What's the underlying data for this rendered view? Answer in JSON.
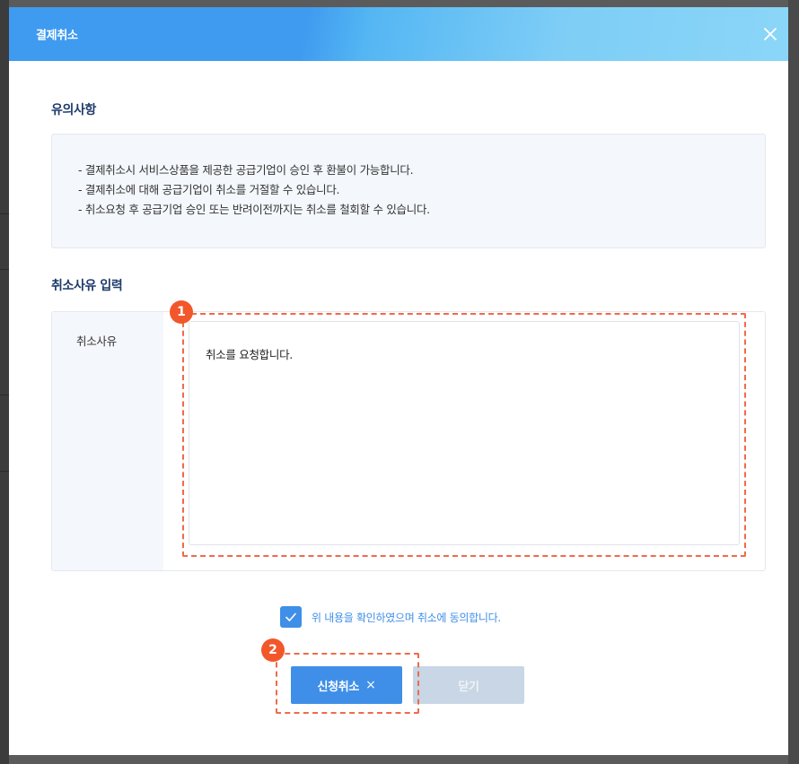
{
  "modal": {
    "title": "결제취소",
    "close_icon": "close-icon"
  },
  "notice": {
    "title": "유의사항",
    "lines": [
      "- 결제취소시 서비스상품을 제공한 공급기업이 승인 후 환불이 가능합니다.",
      "- 결제취소에 대해 공급기업이 취소를 거절할 수 있습니다.",
      "- 취소요청 후 공급기업 승인 또는 반려이전까지는 취소를 철회할 수 있습니다."
    ]
  },
  "reason": {
    "title": "취소사유 입력",
    "label": "취소사유",
    "value": "취소를 요청합니다."
  },
  "agreement": {
    "checked": true,
    "text": "위 내용을 확인하였으며 취소에 동의합니다."
  },
  "buttons": {
    "apply_label": "신청취소",
    "apply_icon": "×",
    "close_label": "닫기"
  },
  "annotations": {
    "step1": "1",
    "step2": "2"
  },
  "colors": {
    "primary": "#3f8fe8",
    "header_start": "#3f9bf0",
    "header_end": "#8bd6f8",
    "highlight": "#f2572b",
    "disabled_button": "#c8d6e5"
  }
}
